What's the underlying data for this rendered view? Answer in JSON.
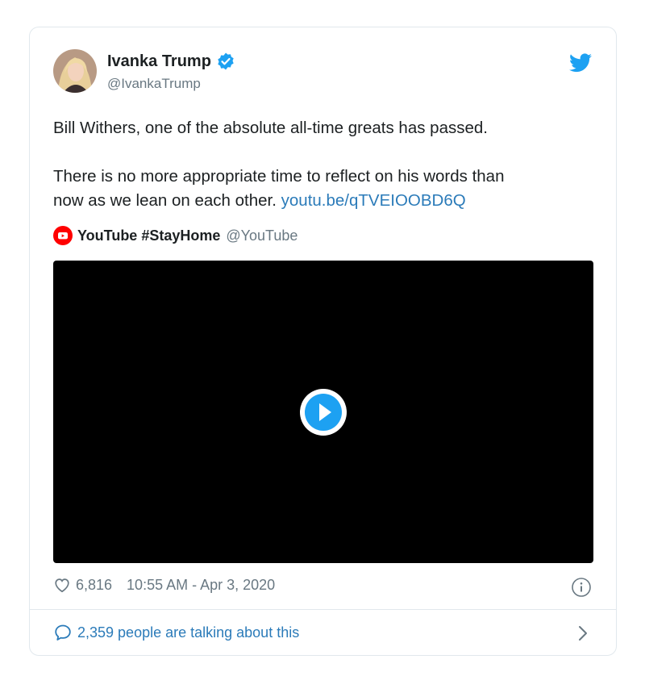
{
  "author": {
    "name": "Ivanka Trump",
    "handle": "@IvankaTrump"
  },
  "tweet": {
    "line1": "Bill Withers, one of the absolute all-time greats has passed.",
    "line2": "There is no more appropriate time to reflect on his words than",
    "line3": "now as we lean on each other.",
    "link": "youtu.be/qTVEIOOBD6Q"
  },
  "quoted": {
    "name": "YouTube #StayHome",
    "handle": "@YouTube"
  },
  "meta": {
    "likes": "6,816",
    "timestamp": "10:55 AM - Apr 3, 2020"
  },
  "footer": {
    "talking": "2,359 people are talking about this"
  },
  "colors": {
    "link": "#2b7bb9",
    "verified": "#1da1f2",
    "youtube_red": "#ff0000",
    "muted": "#697882"
  },
  "icons": [
    "verified-badge-icon",
    "twitter-bird-icon",
    "youtube-logo-icon",
    "play-icon",
    "heart-icon",
    "info-icon",
    "comment-bubble-icon",
    "chevron-right-icon"
  ]
}
